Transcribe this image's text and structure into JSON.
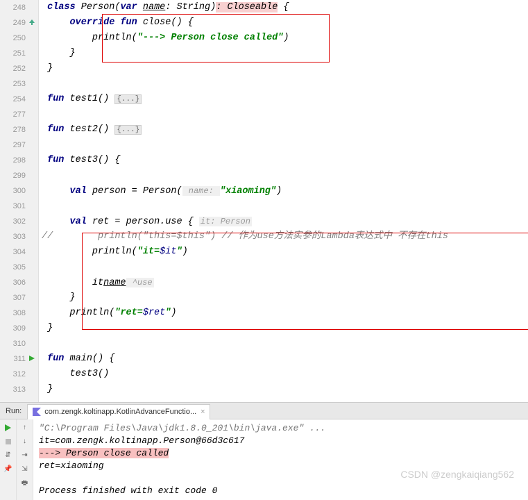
{
  "lines": [
    {
      "n": "248",
      "ico": ""
    },
    {
      "n": "249",
      "ico": "up"
    },
    {
      "n": "250",
      "ico": ""
    },
    {
      "n": "251",
      "ico": ""
    },
    {
      "n": "252",
      "ico": ""
    },
    {
      "n": "253",
      "ico": ""
    },
    {
      "n": "254",
      "ico": ""
    },
    {
      "n": "277",
      "ico": ""
    },
    {
      "n": "278",
      "ico": ""
    },
    {
      "n": "297",
      "ico": ""
    },
    {
      "n": "298",
      "ico": ""
    },
    {
      "n": "299",
      "ico": ""
    },
    {
      "n": "300",
      "ico": ""
    },
    {
      "n": "301",
      "ico": ""
    },
    {
      "n": "302",
      "ico": ""
    },
    {
      "n": "303",
      "ico": ""
    },
    {
      "n": "304",
      "ico": ""
    },
    {
      "n": "305",
      "ico": ""
    },
    {
      "n": "306",
      "ico": ""
    },
    {
      "n": "307",
      "ico": ""
    },
    {
      "n": "308",
      "ico": ""
    },
    {
      "n": "309",
      "ico": ""
    },
    {
      "n": "310",
      "ico": ""
    },
    {
      "n": "311",
      "ico": "run"
    },
    {
      "n": "312",
      "ico": ""
    },
    {
      "n": "313",
      "ico": ""
    }
  ],
  "c": {
    "class": "class",
    "person": "Person",
    "var": "var",
    "name": "name",
    "string": "String",
    "closeable": ": Closeable",
    "ob": " {",
    "cb": "}",
    "override": "override",
    "fun": "fun",
    "close": "close",
    "pp": "() {",
    "println": "println",
    "s1": "\"---> Person close called\"",
    "test1": "test1",
    "test2": "test2",
    "test3": "test3",
    "fold": "{...}",
    "val": "val",
    "eq": " = ",
    "pers": "person",
    "new": "Person(",
    "hint_name": " name: ",
    "s2": "\"xiaoming\"",
    "cp": ")",
    "ret": "ret",
    "use": ".use",
    "ob2": " { ",
    "hint_it": "it: Person",
    "cmt1": "//        println(\"this=$this\") // 作为use方法实参的Lambda表达式中 不存在this",
    "s3": "\"it=",
    "dit": "$it",
    "s3b": "\"",
    "it": "it",
    ".": ".",
    "name2": "name",
    "huse": " ^use",
    "s4": "\"ret=",
    "dret": "$ret",
    "s4b": "\"",
    "main": "main",
    "t3": "test3()"
  },
  "run": {
    "label": "Run:",
    "tab": "com.zengk.koltinapp.KotlinAdvanceFunctio...",
    "o1": "\"C:\\Program Files\\Java\\jdk1.8.0_201\\bin\\java.exe\" ...",
    "o2": "it=com.zengk.koltinapp.Person@66d3c617",
    "o3": "---> Person close called",
    "o4": "ret=xiaoming",
    "o5": "Process finished with exit code 0"
  },
  "watermark": "CSDN @zengkaiqiang562"
}
